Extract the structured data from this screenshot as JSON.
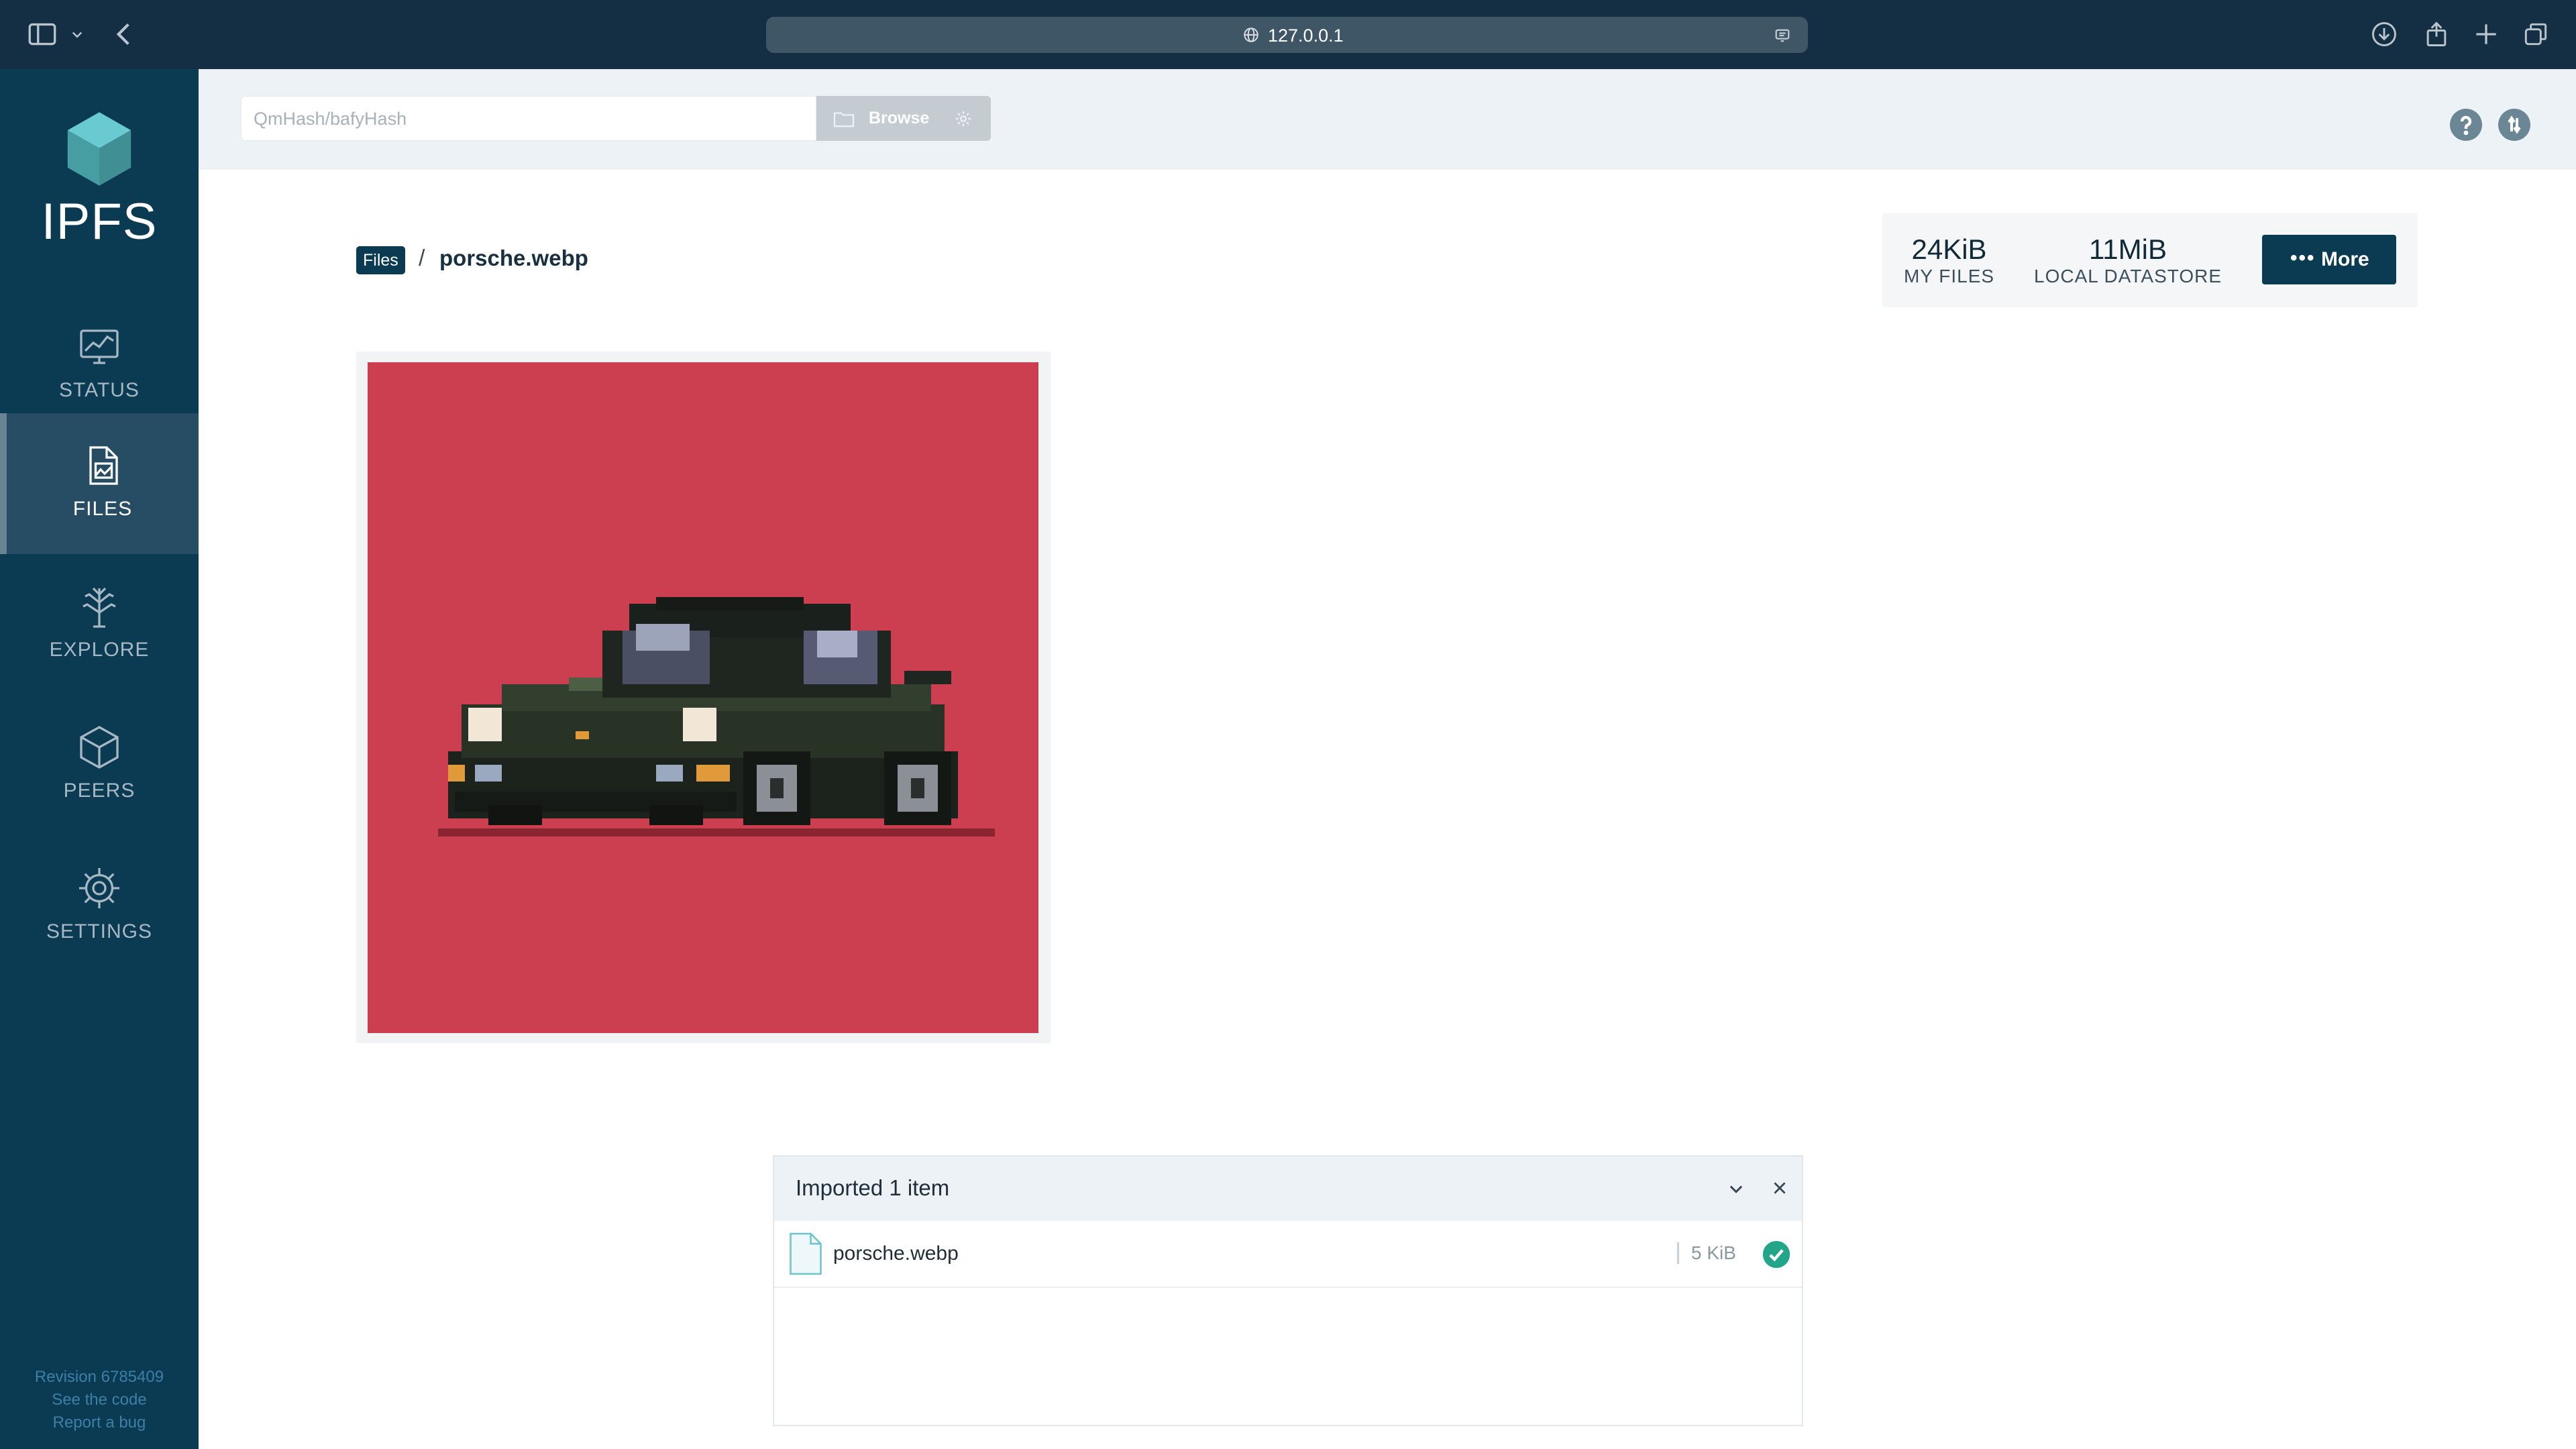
{
  "browser": {
    "url": "127.0.0.1"
  },
  "sidebar": {
    "brand": "IPFS",
    "items": [
      {
        "label": "STATUS",
        "icon": "status-chart-icon"
      },
      {
        "label": "FILES",
        "icon": "files-icon",
        "active": true
      },
      {
        "label": "EXPLORE",
        "icon": "explore-tree-icon"
      },
      {
        "label": "PEERS",
        "icon": "peers-cube-icon"
      },
      {
        "label": "SETTINGS",
        "icon": "settings-gear-icon"
      }
    ],
    "footer": {
      "revision": "Revision 6785409",
      "code_link": "See the code",
      "bug_link": "Report a bug"
    }
  },
  "header": {
    "search_placeholder": "QmHash/bafyHash",
    "browse_label": "Browse"
  },
  "breadcrumb": {
    "root": "Files",
    "separator": "/",
    "current": "porsche.webp"
  },
  "stats": {
    "my_files_value": "24KiB",
    "my_files_label": "MY FILES",
    "datastore_value": "11MiB",
    "datastore_label": "LOCAL DATASTORE",
    "more_label": "More"
  },
  "preview": {
    "subject": "pixel-art black car on red background",
    "background_color": "#cc3f50"
  },
  "import_panel": {
    "title": "Imported 1 item",
    "files": [
      {
        "name": "porsche.webp",
        "size": "5 KiB",
        "status": "done"
      }
    ]
  },
  "colors": {
    "sidebar": "#0b3a53",
    "chrome": "#142f43",
    "accent_teal": "#22a589"
  }
}
